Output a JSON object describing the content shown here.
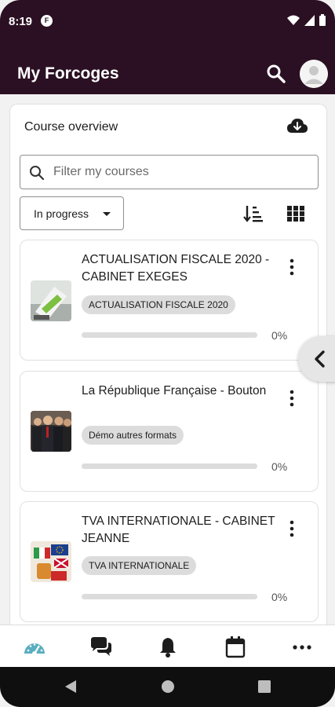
{
  "status_bar": {
    "time": "8:19",
    "app_icon_letter": "F"
  },
  "app_bar": {
    "title": "My Forcoges"
  },
  "overview": {
    "title": "Course overview"
  },
  "filter": {
    "placeholder": "Filter my courses"
  },
  "progress_filter": {
    "selected": "In progress"
  },
  "courses": [
    {
      "title": "ACTUALISATION FISCALE 2020 - CABINET EXEGES",
      "category": "ACTUALISATION FISCALE 2020",
      "progress_label": "0%",
      "progress": 0
    },
    {
      "title": "La République Française - Bouton",
      "category": "Démo autres formats",
      "progress_label": "0%",
      "progress": 0
    },
    {
      "title": "TVA INTERNATIONALE - CABINET JEANNE",
      "category": "TVA INTERNATIONALE",
      "progress_label": "0%",
      "progress": 0
    }
  ],
  "bottom_nav": [
    "dashboard-icon",
    "messages-icon",
    "notifications-icon",
    "calendar-icon",
    "more-icon"
  ],
  "colors": {
    "brand": "#2b1023",
    "accent_dashboard": "#5aaec0"
  }
}
